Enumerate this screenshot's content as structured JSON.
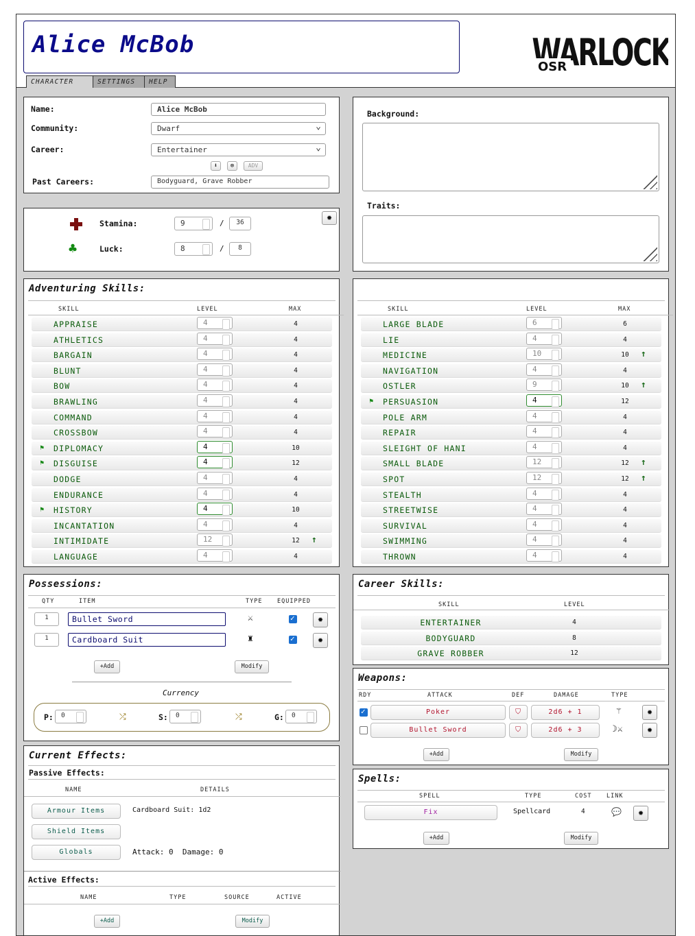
{
  "character_name": "Alice McBob",
  "logo": {
    "main": "WARLOCK!",
    "sub": "OSR"
  },
  "tabs": [
    "CHARACTER",
    "SETTINGS",
    "HELP"
  ],
  "info": {
    "name_label": "Name:",
    "name_value": "Alice McBob",
    "community_label": "Community:",
    "community_value": "Dwarf",
    "career_label": "Career:",
    "career_value": "Entertainer",
    "adv_label": "ADV",
    "past_label": "Past Careers:",
    "past_value": "Bodyguard, Grave Robber"
  },
  "stats": {
    "stamina_label": "Stamina:",
    "stamina_current": "9",
    "stamina_max": "36",
    "luck_label": "Luck:",
    "luck_current": "8",
    "luck_max": "8",
    "slash": "/"
  },
  "bio": {
    "background_label": "Background:",
    "traits_label": "Traits:"
  },
  "adventuring": {
    "title": "Adventuring Skills:",
    "headers": {
      "skill": "Skill",
      "level": "Level",
      "max": "Max"
    },
    "left": [
      {
        "name": "APPRAISE",
        "level": "4",
        "max": "4",
        "flag": false,
        "up": false
      },
      {
        "name": "ATHLETICS",
        "level": "4",
        "max": "4",
        "flag": false,
        "up": false
      },
      {
        "name": "BARGAIN",
        "level": "4",
        "max": "4",
        "flag": false,
        "up": false
      },
      {
        "name": "BLUNT",
        "level": "4",
        "max": "4",
        "flag": false,
        "up": false
      },
      {
        "name": "BOW",
        "level": "4",
        "max": "4",
        "flag": false,
        "up": false
      },
      {
        "name": "BRAWLING",
        "level": "4",
        "max": "4",
        "flag": false,
        "up": false
      },
      {
        "name": "COMMAND",
        "level": "4",
        "max": "4",
        "flag": false,
        "up": false
      },
      {
        "name": "CROSSBOW",
        "level": "4",
        "max": "4",
        "flag": false,
        "up": false
      },
      {
        "name": "DIPLOMACY",
        "level": "4",
        "max": "10",
        "flag": true,
        "up": false
      },
      {
        "name": "DISGUISE",
        "level": "4",
        "max": "12",
        "flag": true,
        "up": false
      },
      {
        "name": "DODGE",
        "level": "4",
        "max": "4",
        "flag": false,
        "up": false
      },
      {
        "name": "ENDURANCE",
        "level": "4",
        "max": "4",
        "flag": false,
        "up": false
      },
      {
        "name": "HISTORY",
        "level": "4",
        "max": "10",
        "flag": true,
        "up": false
      },
      {
        "name": "INCANTATION",
        "level": "4",
        "max": "4",
        "flag": false,
        "up": false
      },
      {
        "name": "INTIMIDATE",
        "level": "12",
        "max": "12",
        "flag": false,
        "up": true
      },
      {
        "name": "LANGUAGE",
        "level": "4",
        "max": "4",
        "flag": false,
        "up": false
      }
    ],
    "right": [
      {
        "name": "LARGE BLADE",
        "level": "6",
        "max": "6",
        "flag": false,
        "up": false
      },
      {
        "name": "LIE",
        "level": "4",
        "max": "4",
        "flag": false,
        "up": false
      },
      {
        "name": "MEDICINE",
        "level": "10",
        "max": "10",
        "flag": false,
        "up": true
      },
      {
        "name": "NAVIGATION",
        "level": "4",
        "max": "4",
        "flag": false,
        "up": false
      },
      {
        "name": "OSTLER",
        "level": "9",
        "max": "10",
        "flag": false,
        "up": true
      },
      {
        "name": "PERSUASION",
        "level": "4",
        "max": "12",
        "flag": true,
        "up": false
      },
      {
        "name": "POLE ARM",
        "level": "4",
        "max": "4",
        "flag": false,
        "up": false
      },
      {
        "name": "REPAIR",
        "level": "4",
        "max": "4",
        "flag": false,
        "up": false
      },
      {
        "name": "SLEIGHT OF HANI",
        "level": "4",
        "max": "4",
        "flag": false,
        "up": false
      },
      {
        "name": "SMALL BLADE",
        "level": "12",
        "max": "12",
        "flag": false,
        "up": true
      },
      {
        "name": "SPOT",
        "level": "12",
        "max": "12",
        "flag": false,
        "up": true
      },
      {
        "name": "STEALTH",
        "level": "4",
        "max": "4",
        "flag": false,
        "up": false
      },
      {
        "name": "STREETWISE",
        "level": "4",
        "max": "4",
        "flag": false,
        "up": false
      },
      {
        "name": "SURVIVAL",
        "level": "4",
        "max": "4",
        "flag": false,
        "up": false
      },
      {
        "name": "SWIMMING",
        "level": "4",
        "max": "4",
        "flag": false,
        "up": false
      },
      {
        "name": "THROWN",
        "level": "4",
        "max": "4",
        "flag": false,
        "up": false
      }
    ]
  },
  "possessions": {
    "title": "Possessions:",
    "headers": {
      "qty": "Qty",
      "item": "Item",
      "type": "Type",
      "equipped": "Equipped"
    },
    "items": [
      {
        "qty": "1",
        "name": "Bullet Sword",
        "type_icon": "sword-icon",
        "equipped": true
      },
      {
        "qty": "1",
        "name": "Cardboard Suit",
        "type_icon": "armour-icon",
        "equipped": true
      }
    ],
    "add_label": "+Add",
    "modify_label": "Modify",
    "currency_label": "Currency",
    "currency": {
      "p_label": "P:",
      "p": "0",
      "s_label": "S:",
      "s": "0",
      "g_label": "G:",
      "g": "0"
    }
  },
  "career_skills": {
    "title": "Career Skills:",
    "headers": {
      "skill": "Skill",
      "level": "Level"
    },
    "rows": [
      {
        "name": "ENTERTAINER",
        "level": "4"
      },
      {
        "name": "BODYGUARD",
        "level": "8"
      },
      {
        "name": "GRAVE ROBBER",
        "level": "12"
      }
    ]
  },
  "weapons": {
    "title": "Weapons:",
    "headers": {
      "rdy": "Rdy",
      "attack": "Attack",
      "def": "Def",
      "damage": "Damage",
      "type": "Type"
    },
    "rows": [
      {
        "ready": true,
        "attack": "Poker",
        "damage": "2d6 + 1",
        "type_icon": "trident-icon"
      },
      {
        "ready": false,
        "attack": "Bullet Sword",
        "damage": "2d6 + 3",
        "type_icon": "swing-icon"
      }
    ],
    "add_label": "+Add",
    "modify_label": "Modify"
  },
  "spells": {
    "title": "Spells:",
    "headers": {
      "spell": "Spell",
      "type": "Type",
      "cost": "Cost",
      "link": "Link"
    },
    "rows": [
      {
        "name": "Fix",
        "type": "Spellcard",
        "cost": "4"
      }
    ],
    "add_label": "+Add",
    "modify_label": "Modify"
  },
  "effects": {
    "title": "Current Effects:",
    "passive_label": "Passive Effects:",
    "passive_headers": {
      "name": "Name",
      "details": "Details"
    },
    "passive": [
      {
        "name": "Armour Items",
        "details": "Cardboard Suit: 1d2"
      },
      {
        "name": "Shield Items",
        "details": ""
      },
      {
        "name": "Globals",
        "details": "Attack: 0  Damage: 0"
      }
    ],
    "active_label": "Active Effects:",
    "active_headers": {
      "name": "Name",
      "type": "Type",
      "source": "Source",
      "active": "Active"
    },
    "add_label": "+Add",
    "modify_label": "Modify"
  },
  "colors": {
    "accent": "#0b0b8a",
    "skill_green": "#0a5a0a",
    "attack_red": "#b0102a",
    "spell_purple": "#a020a0"
  }
}
